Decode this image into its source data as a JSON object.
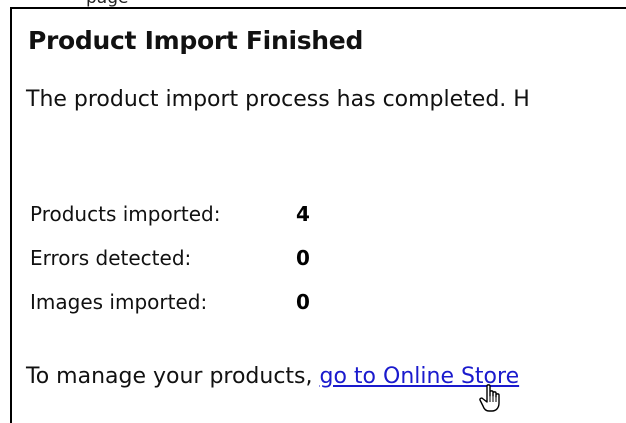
{
  "header": {
    "partial_text": "page"
  },
  "dialog": {
    "title": "Product Import Finished",
    "intro_text": "The product import process has completed. H"
  },
  "stats": [
    {
      "label": "Products imported:",
      "value": "4"
    },
    {
      "label": "Errors detected:",
      "value": "0"
    },
    {
      "label": "Images imported:",
      "value": "0"
    }
  ],
  "footer": {
    "prefix_text": "To manage your products, ",
    "link_label": "go to Online Store"
  },
  "colors": {
    "link": "#1a1acd",
    "border": "#000000"
  },
  "cursor": {
    "icon": "hand-pointer-icon"
  }
}
